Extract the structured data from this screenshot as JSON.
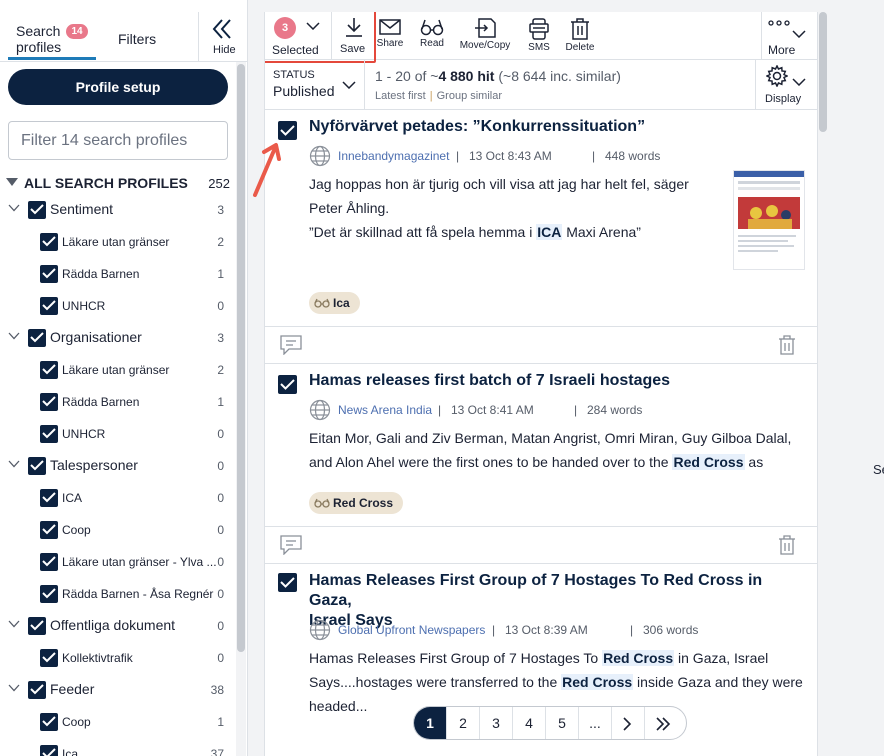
{
  "left_panel": {
    "tabs": {
      "search_profiles_line1": "Search",
      "search_profiles_line2": "profiles",
      "search_profiles_badge": "14",
      "filters": "Filters",
      "hide": "Hide"
    },
    "profile_setup_label": "Profile setup",
    "filter_placeholder": "Filter 14 search profiles",
    "all_profiles": {
      "label": "ALL SEARCH PROFILES",
      "count": "252"
    },
    "tree": [
      {
        "name": "Sentiment",
        "count": "3",
        "level": 0
      },
      {
        "name": "Läkare utan gränser",
        "count": "2",
        "level": 1
      },
      {
        "name": "Rädda Barnen",
        "count": "1",
        "level": 1
      },
      {
        "name": "UNHCR",
        "count": "0",
        "level": 1
      },
      {
        "name": "Organisationer",
        "count": "3",
        "level": 0
      },
      {
        "name": "Läkare utan gränser",
        "count": "2",
        "level": 1
      },
      {
        "name": "Rädda Barnen",
        "count": "1",
        "level": 1
      },
      {
        "name": "UNHCR",
        "count": "0",
        "level": 1
      },
      {
        "name": "Talespersoner",
        "count": "0",
        "level": 0
      },
      {
        "name": "ICA",
        "count": "0",
        "level": 1
      },
      {
        "name": "Coop",
        "count": "0",
        "level": 1
      },
      {
        "name": "Läkare utan gränser - Ylva ...",
        "count": "0",
        "level": 1
      },
      {
        "name": "Rädda Barnen - Åsa Regnér",
        "count": "0",
        "level": 1
      },
      {
        "name": "Offentliga dokument",
        "count": "0",
        "level": 0
      },
      {
        "name": "Kollektivtrafik",
        "count": "0",
        "level": 1
      },
      {
        "name": "Feeder",
        "count": "38",
        "level": 0
      },
      {
        "name": "Coop",
        "count": "1",
        "level": 1
      },
      {
        "name": "Ica",
        "count": "37",
        "level": 1
      }
    ]
  },
  "toolbar": {
    "selected_count": "3",
    "selected_label": "Selected",
    "save_label": "Save",
    "share_label": "Share",
    "read_label": "Read",
    "move_copy_label": "Move/Copy",
    "sms_label": "SMS",
    "delete_label": "Delete",
    "more_label": "More"
  },
  "status_bar": {
    "status_key": "STATUS",
    "status_value": "Published",
    "hits_prefix": "1 - 20 of ~",
    "hits_count": "4 880 hit",
    "hits_suffix": " (~8 644 inc. similar)",
    "sort_latest": "Latest first",
    "sort_group": "Group similar",
    "display_label": "Display"
  },
  "articles": [
    {
      "title": "Nyförvärvet petades: ”Konkurrenssituation”",
      "source": "Innebandymagazinet",
      "date": "13 Oct 8:43 AM",
      "words": "448 words",
      "body_1": "Jag hoppas hon är tjurig och vill visa att jag har helt fel, säger",
      "body_2": "Peter Åhling.",
      "body_3a": "”Det är skillnad att få spela hemma i ",
      "body_3b": "ICA",
      "body_3c": " Maxi Arena”",
      "tag": "Ica"
    },
    {
      "title": "Hamas releases first batch of 7 Israeli hostages",
      "source": "News Arena India",
      "date": "13 Oct 8:41 AM",
      "words": "284 words",
      "body_1": "Eitan Mor, Gali and Ziv Berman, Matan Angrist, Omri Miran, Guy Gilboa Dalal,",
      "body_2a": "and Alon Ahel were the first ones to be handed over to the ",
      "body_2b": "Red Cross",
      "body_2c": " as",
      "tag": "Red Cross"
    },
    {
      "title_1": "Hamas Releases First Group of 7 Hostages To Red Cross in Gaza,",
      "title_2": "Israel Says",
      "source": "Global Upfront Newspapers",
      "date": "13 Oct 8:39 AM",
      "words": "306 words",
      "body_1a": "Hamas Releases First Group of 7 Hostages To ",
      "body_1b": "Red Cross",
      "body_1c": " in Gaza, Israel",
      "body_2a": "Says....hostages were transferred to the ",
      "body_2b": "Red Cross",
      "body_2c": " inside Gaza and they were",
      "body_3": "headed..."
    }
  ],
  "meta_separator": "|",
  "pagination": {
    "pages": [
      "1",
      "2",
      "3",
      "4",
      "5",
      "..."
    ],
    "active": "1"
  },
  "cut_text": "Se",
  "colors": {
    "navy": "#0c2240",
    "badge_pink": "#e9788a",
    "highlight_red": "#e4483b",
    "accent_blue": "#1e7bb8",
    "tag_beige": "#ede4d4"
  }
}
